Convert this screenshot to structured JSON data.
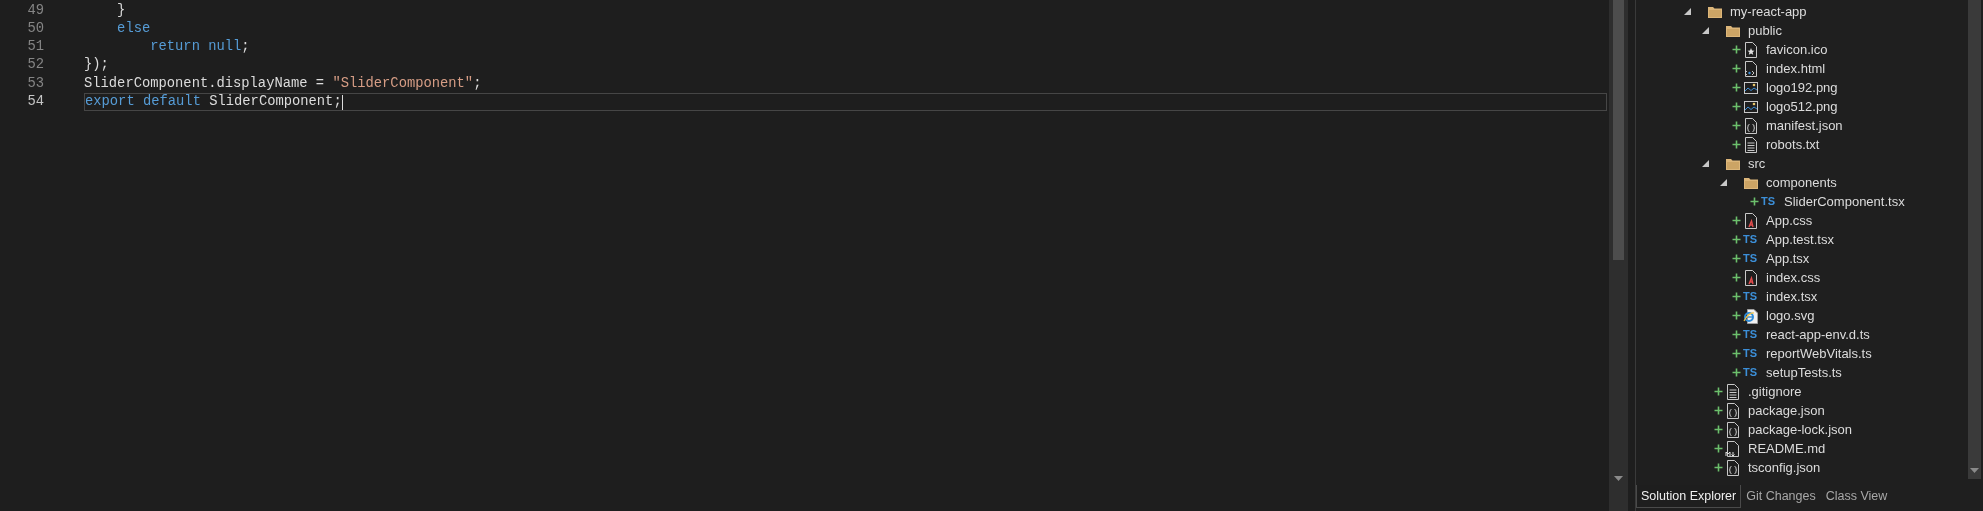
{
  "editor": {
    "lines": [
      {
        "number": "49",
        "current": false,
        "tokens": [
          {
            "text": "    }",
            "kind": "plain"
          }
        ]
      },
      {
        "number": "50",
        "current": false,
        "tokens": [
          {
            "text": "    else",
            "kind": "keyword"
          }
        ]
      },
      {
        "number": "51",
        "current": false,
        "tokens": [
          {
            "text": "        return null",
            "kind": "keyword"
          },
          {
            "text": ";",
            "kind": "plain"
          }
        ]
      },
      {
        "number": "52",
        "current": false,
        "tokens": [
          {
            "text": "});",
            "kind": "plain"
          }
        ]
      },
      {
        "number": "53",
        "current": false,
        "tokens": [
          {
            "text": "SliderComponent.displayName = ",
            "kind": "plain"
          },
          {
            "text": "\"SliderComponent\"",
            "kind": "string"
          },
          {
            "text": ";",
            "kind": "plain"
          }
        ]
      },
      {
        "number": "54",
        "current": true,
        "tokens": [
          {
            "text": "export default",
            "kind": "keyword"
          },
          {
            "text": " SliderComponent;",
            "kind": "plain"
          }
        ]
      }
    ]
  },
  "solution_explorer": {
    "tree": [
      {
        "name": "my-react-app",
        "kind": "folder",
        "expanded": true,
        "children": [
          {
            "name": "public",
            "kind": "folder",
            "expanded": true,
            "children": [
              {
                "name": "favicon.ico",
                "kind": "favicon",
                "added": true
              },
              {
                "name": "index.html",
                "kind": "html",
                "added": true
              },
              {
                "name": "logo192.png",
                "kind": "image",
                "added": true
              },
              {
                "name": "logo512.png",
                "kind": "image",
                "added": true
              },
              {
                "name": "manifest.json",
                "kind": "json",
                "added": true
              },
              {
                "name": "robots.txt",
                "kind": "text",
                "added": true
              }
            ]
          },
          {
            "name": "src",
            "kind": "folder",
            "expanded": true,
            "children": [
              {
                "name": "components",
                "kind": "folder",
                "expanded": true,
                "children": [
                  {
                    "name": "SliderComponent.tsx",
                    "kind": "ts",
                    "badge": "TS",
                    "added": true
                  }
                ]
              },
              {
                "name": "App.css",
                "kind": "css",
                "added": true
              },
              {
                "name": "App.test.tsx",
                "kind": "ts",
                "badge": "TS",
                "added": true
              },
              {
                "name": "App.tsx",
                "kind": "ts",
                "badge": "TS",
                "added": true
              },
              {
                "name": "index.css",
                "kind": "css",
                "added": true
              },
              {
                "name": "index.tsx",
                "kind": "ts",
                "badge": "TS",
                "added": true
              },
              {
                "name": "logo.svg",
                "kind": "browser",
                "added": true
              },
              {
                "name": "react-app-env.d.ts",
                "kind": "ts",
                "badge": "TS",
                "added": true
              },
              {
                "name": "reportWebVitals.ts",
                "kind": "ts",
                "badge": "TS",
                "added": true
              },
              {
                "name": "setupTests.ts",
                "kind": "ts",
                "badge": "TS",
                "added": true
              }
            ]
          },
          {
            "name": ".gitignore",
            "kind": "text",
            "added": true
          },
          {
            "name": "package.json",
            "kind": "json",
            "added": true
          },
          {
            "name": "package-lock.json",
            "kind": "json",
            "added": true
          },
          {
            "name": "README.md",
            "kind": "markdown",
            "added": true
          },
          {
            "name": "tsconfig.json",
            "kind": "json",
            "added": true
          }
        ]
      }
    ],
    "tabs": [
      {
        "label": "Solution Explorer",
        "selected": true
      },
      {
        "label": "Git Changes",
        "selected": false
      },
      {
        "label": "Class View",
        "selected": false
      }
    ]
  }
}
